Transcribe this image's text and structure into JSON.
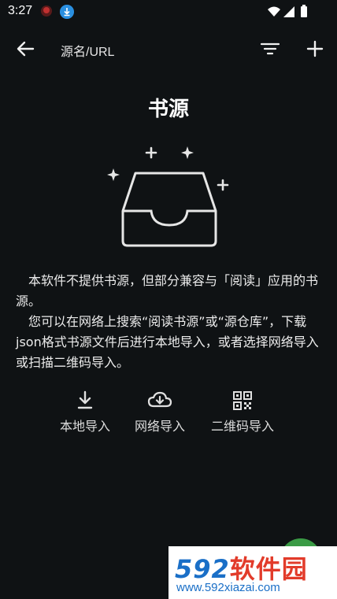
{
  "status_bar": {
    "time": "3:27"
  },
  "toolbar": {
    "search_placeholder": "源名/URL"
  },
  "empty_state": {
    "title": "书源",
    "paragraph1": "本软件不提供书源，但部分兼容与「阅读」应用的书源。",
    "paragraph2": "您可以在网络上搜索“阅读书源”或“源仓库”，下载json格式书源文件后进行本地导入，或者选择网络导入或扫描二维码导入。"
  },
  "actions": [
    {
      "label": "本地导入",
      "icon": "download-icon"
    },
    {
      "label": "网络导入",
      "icon": "cloud-download-icon"
    },
    {
      "label": "二维码导入",
      "icon": "qr-code-icon"
    }
  ],
  "watermark": {
    "brand_number": "592",
    "brand_name": "软件园",
    "url": "www.592xiazai.com"
  },
  "colors": {
    "background": "#0f1214",
    "fab": "#3a9a45",
    "watermark_blue": "#1a6fc7",
    "watermark_red": "#e23b2a"
  }
}
